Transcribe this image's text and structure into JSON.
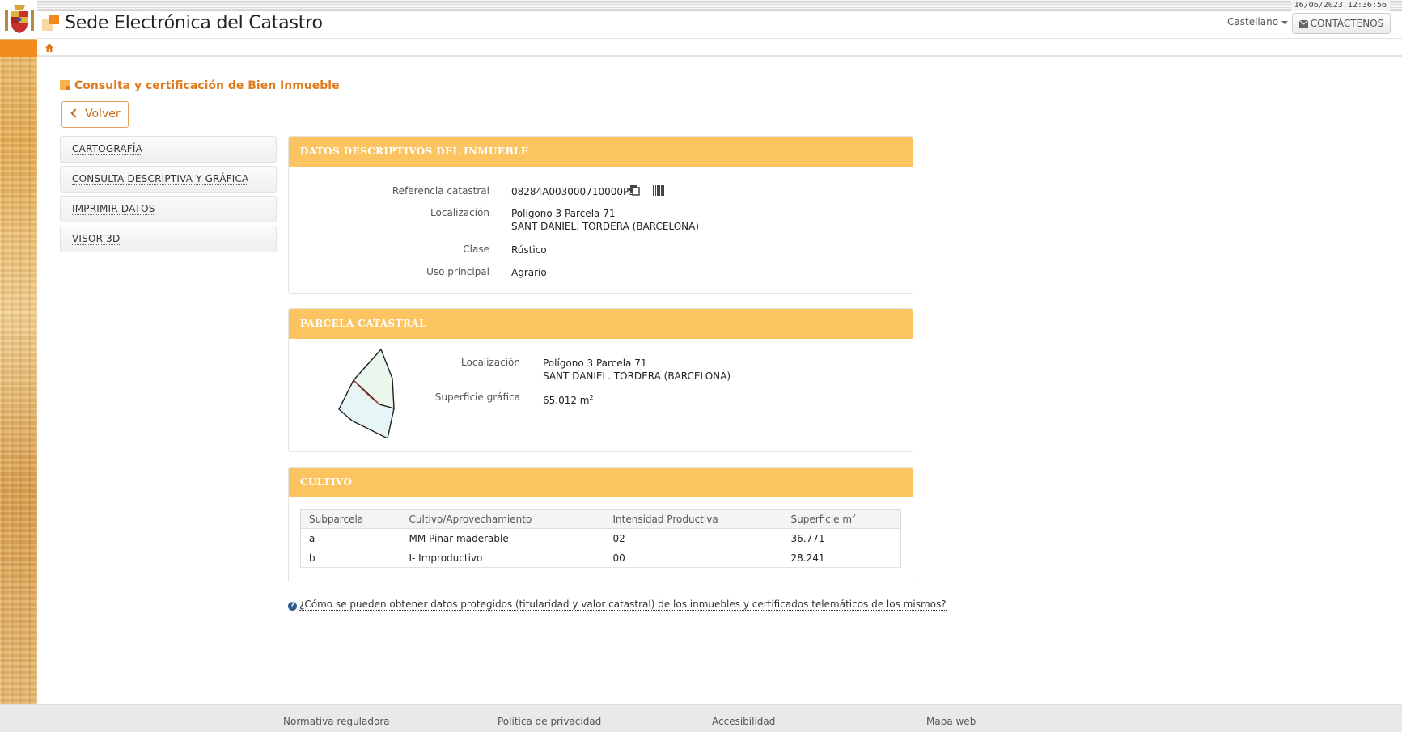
{
  "datebar": {
    "datetime": "16/06/2023 12:36:56"
  },
  "header": {
    "site_title": "Sede Electrónica del Catastro",
    "language": "Castellano",
    "contact_label": "CONTÁCTENOS"
  },
  "page": {
    "heading": "Consulta y certificación de Bien Inmueble",
    "back_label": "Volver"
  },
  "sidebar": {
    "items": [
      {
        "label": "CARTOGRAFÍA"
      },
      {
        "label": "CONSULTA DESCRIPTIVA Y GRÁFICA"
      },
      {
        "label": "IMPRIMIR DATOS"
      },
      {
        "label": "VISOR 3D"
      }
    ]
  },
  "descriptive": {
    "title": "DATOS DESCRIPTIVOS DEL INMUEBLE",
    "ref_label": "Referencia catastral",
    "ref_value": "08284A003000710000PS",
    "loc_label": "Localización",
    "loc_line1": "Polígono 3 Parcela 71",
    "loc_line2": "SANT DANIEL. TORDERA (BARCELONA)",
    "class_label": "Clase",
    "class_value": "Rústico",
    "use_label": "Uso principal",
    "use_value": "Agrario"
  },
  "parcel": {
    "title": "PARCELA CATASTRAL",
    "loc_label": "Localización",
    "loc_line1": "Polígono 3 Parcela 71",
    "loc_line2": "SANT DANIEL. TORDERA (BARCELONA)",
    "surface_label": "Superficie gráfica",
    "surface_value": "65.012 m",
    "surface_unit_sup": "2"
  },
  "cultivation": {
    "title": "CULTIVO",
    "headers": [
      "Subparcela",
      "Cultivo/Aprovechamiento",
      "Intensidad Productiva",
      "Superficie m"
    ],
    "header_sup": "2",
    "rows": [
      [
        "a",
        "MM Pinar maderable",
        "02",
        "36.771"
      ],
      [
        "b",
        "I- Improductivo",
        "00",
        "28.241"
      ]
    ]
  },
  "help": {
    "text": "¿Cómo se pueden obtener datos protegidos (titularidad y valor catastral) de los inmuebles y certificados telemáticos de los mismos?"
  },
  "footer": {
    "links": [
      "Normativa reguladora",
      "Política de privacidad",
      "Accesibilidad",
      "Mapa web"
    ]
  },
  "colors": {
    "accent_orange": "#f28a1e",
    "panel_header": "#fcc460",
    "heading_text": "#e07a1e"
  },
  "icons": [
    "home-icon",
    "copy-icon",
    "barcode-icon",
    "mail-icon",
    "help-icon",
    "chevron-left-icon",
    "caret-down-icon"
  ]
}
